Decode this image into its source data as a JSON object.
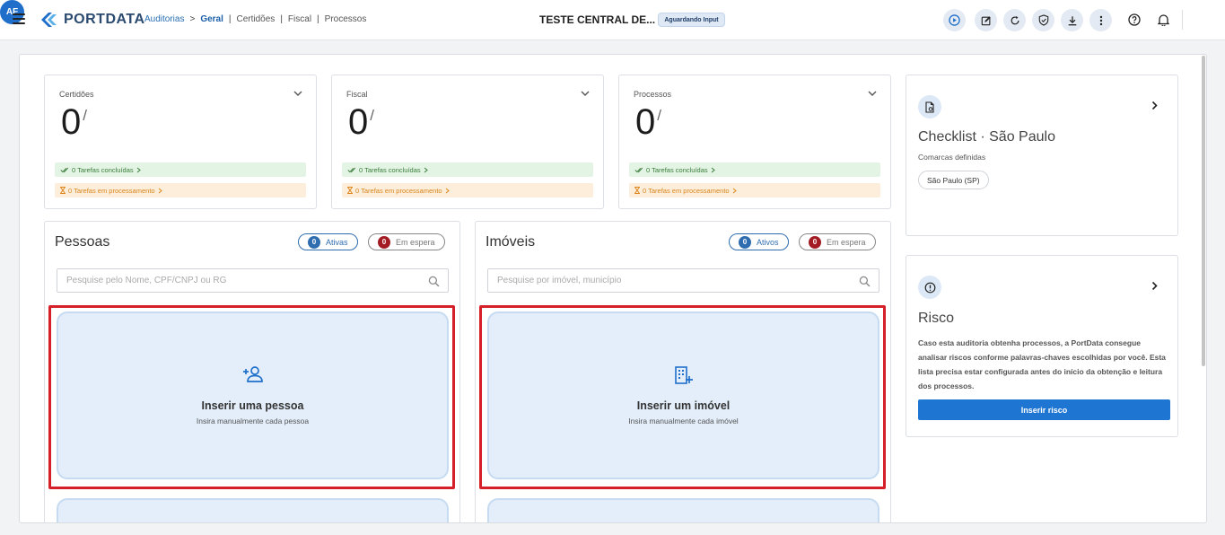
{
  "header": {
    "logo_text": "PORTDATA",
    "breadcrumbs": [
      {
        "label": "Auditorias"
      },
      {
        "label": ">"
      },
      {
        "label": "Geral"
      },
      {
        "label": "|"
      },
      {
        "label": "Certidões"
      },
      {
        "label": "|"
      },
      {
        "label": "Fiscal"
      },
      {
        "label": "|"
      },
      {
        "label": "Processos"
      }
    ],
    "title": "TESTE CENTRAL DE...",
    "status": "Aguardando Input",
    "avatar_initials": "AF",
    "accent": "#1f6fca"
  },
  "stats": [
    {
      "title": "Certidões",
      "count": "0",
      "slash": "/",
      "done": "0 Tarefas concluídas",
      "processing": "0 Tarefas em processamento"
    },
    {
      "title": "Fiscal",
      "count": "0",
      "slash": "/",
      "done": "0 Tarefas concluídas",
      "processing": "0 Tarefas em processamento"
    },
    {
      "title": "Processos",
      "count": "0",
      "slash": "/",
      "done": "0 Tarefas concluídas",
      "processing": "0 Tarefas em processamento"
    }
  ],
  "pessoas": {
    "title": "Pessoas",
    "active_count": "0",
    "active_label": "Ativas",
    "waiting_count": "0",
    "waiting_label": "Em espera",
    "search_placeholder": "Pesquise pelo Nome, CPF/CNPJ ou RG",
    "insert_title": "Inserir uma pessoa",
    "insert_sub": "Insira manualmente cada pessoa"
  },
  "imoveis": {
    "title": "Imóveis",
    "active_count": "0",
    "active_label": "Ativos",
    "waiting_count": "0",
    "waiting_label": "Em espera",
    "search_placeholder": "Pesquise por imóvel, município",
    "insert_title": "Inserir um imóvel",
    "insert_sub": "Insira manualmente cada imóvel"
  },
  "checklist": {
    "title": "Checklist · São Paulo",
    "subtitle": "Comarcas definidas",
    "tag": "São Paulo (SP)"
  },
  "risco": {
    "title": "Risco",
    "description": "Caso esta auditoria obtenha processos, a PortData consegue analisar riscos conforme palavras-chaves escolhidas por você. Esta lista precisa estar configurada antes do início da obtenção e leitura dos processos.",
    "button": "Inserir risco"
  },
  "colors": {
    "active_blue": "#2f6db1",
    "waiting_red": "#a31b23",
    "highlight_red": "#d5202a",
    "done_green": "#3a7d3a",
    "processing_orange": "#d9861c"
  }
}
